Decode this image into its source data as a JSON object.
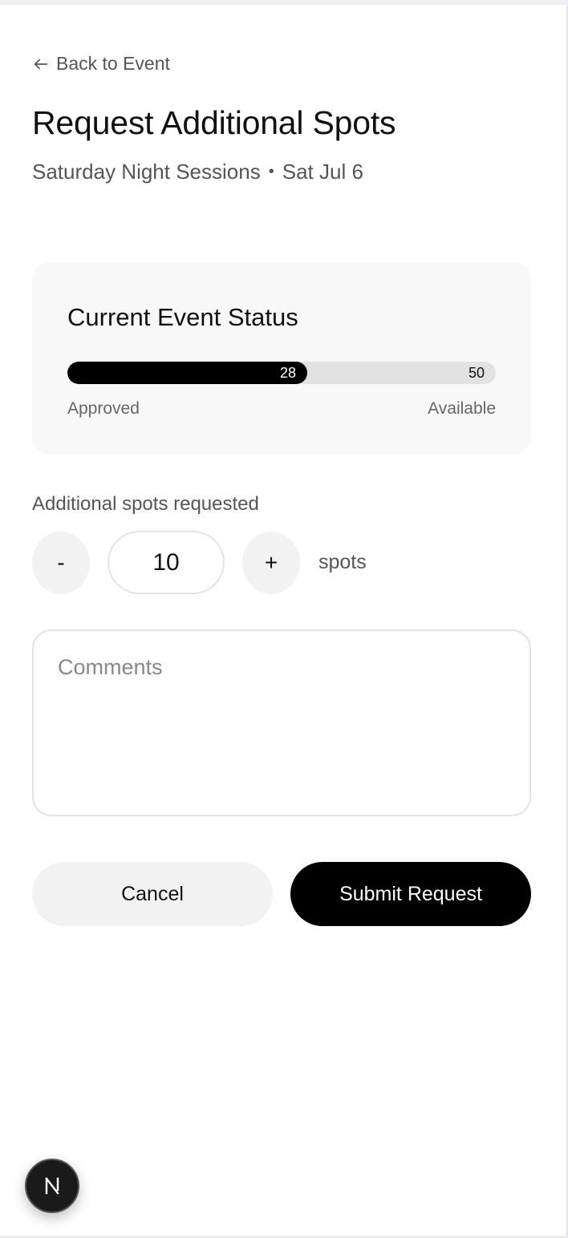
{
  "nav": {
    "back_label": "Back to Event"
  },
  "header": {
    "title": "Request Additional Spots",
    "event_name": "Saturday Night Sessions",
    "separator": "•",
    "event_date": "Sat Jul 6"
  },
  "status": {
    "title": "Current Event Status",
    "approved": 28,
    "available": 50,
    "approved_label": "Approved",
    "available_label": "Available"
  },
  "request": {
    "label": "Additional spots requested",
    "decrement_label": "-",
    "increment_label": "+",
    "value": "10",
    "unit": "spots"
  },
  "comments": {
    "placeholder": "Comments"
  },
  "actions": {
    "cancel_label": "Cancel",
    "submit_label": "Submit Request"
  },
  "fab": {
    "letter": "N"
  }
}
